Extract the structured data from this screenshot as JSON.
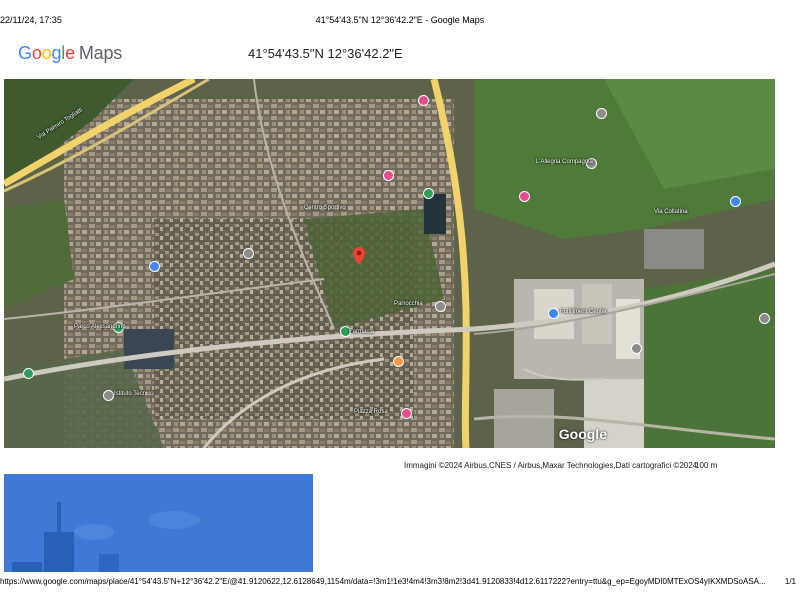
{
  "print_header": {
    "date": "22/11/24, 17:35",
    "title": "41°54'43.5\"N 12°36'42.2\"E - Google Maps"
  },
  "logo": {
    "letters": [
      "G",
      "o",
      "o",
      "g",
      "l",
      "e"
    ],
    "maps": "Maps"
  },
  "place": {
    "coordinates": "41°54'43.5\"N 12°36'42.2\"E"
  },
  "map": {
    "watermark": "Google",
    "labels": [
      {
        "text": "Via Palmiro Togliatti"
      },
      {
        "text": "Centro Sportivo"
      },
      {
        "text": "Parco Alessandrino"
      },
      {
        "text": "Via Collatina"
      },
      {
        "text": "Fulfillment Center"
      },
      {
        "text": "Istituto Tecnico"
      },
      {
        "text": "Parrocchia"
      },
      {
        "text": "Farmacia"
      },
      {
        "text": "L'Allegria Compagnia"
      },
      {
        "text": "Piazza Rosa"
      }
    ]
  },
  "attribution": "Immagini ©2024 Airbus,CNES / Airbus,Maxar Technologies,Dati cartografici ©2024",
  "scale_label": "100 m",
  "footer": {
    "url": "https://www.google.com/maps/place/41°54'43.5\"N+12°36'42.2\"E/@41.9120622,12.6128649,1154m/data=!3m1!1e3!4m4!3m3!8m2!3d41.9120833!4d12.6117222?entry=ttu&g_ep=EgoyMDI0MTExOS4yIKXMDSoASA...",
    "page": "1/1"
  },
  "colors": {
    "map_base": "#5c6349",
    "highway": "#f2d36b",
    "street_view_bg": "#3f78d6"
  }
}
